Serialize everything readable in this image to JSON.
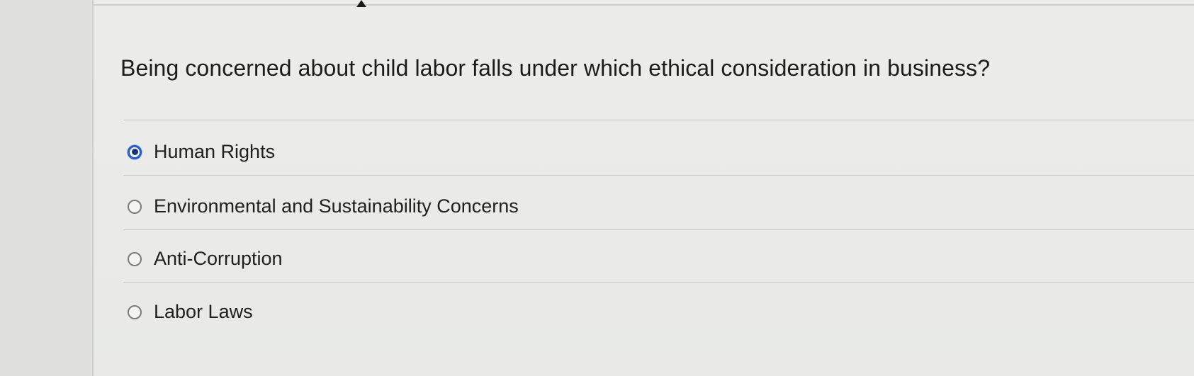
{
  "question": {
    "text": "Being concerned about child labor falls under which ethical consideration in business?"
  },
  "options": [
    {
      "label": "Human Rights",
      "selected": true
    },
    {
      "label": "Environmental and Sustainability Concerns",
      "selected": false
    },
    {
      "label": "Anti-Corruption",
      "selected": false
    },
    {
      "label": "Labor Laws",
      "selected": false
    }
  ],
  "colors": {
    "radio_selected": "#2a5cc4",
    "radio_dot": "#15347e",
    "background": "#eaebe9"
  }
}
